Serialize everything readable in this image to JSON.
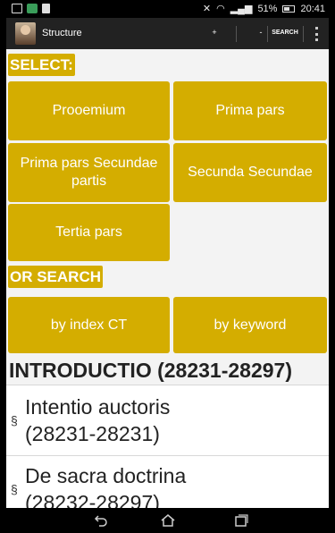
{
  "status_bar": {
    "battery": "51%",
    "time": "20:41"
  },
  "action_bar": {
    "title": "Structure",
    "plus": "+",
    "minus": "-",
    "search": "SEARCH"
  },
  "select_label": "SELECT:",
  "parts": [
    {
      "label": "Prooemium"
    },
    {
      "label": "Prima pars"
    },
    {
      "label": "Prima pars Secundae partis"
    },
    {
      "label": "Secunda Secundae"
    },
    {
      "label": "Tertia pars"
    }
  ],
  "or_search_label": "OR SEARCH",
  "search_options": [
    {
      "label": "by index CT"
    },
    {
      "label": "by keyword"
    }
  ],
  "section_heading": "INTRODUCTIO (28231-28297)",
  "items": [
    {
      "symbol": "§",
      "line1": "Intentio auctoris",
      "line2": "(28231-28231)"
    },
    {
      "symbol": "§",
      "line1": "De sacra doctrina",
      "line2": "(28232-28297)"
    }
  ],
  "colors": {
    "accent": "#d4ad00",
    "actionbar": "#222222"
  }
}
